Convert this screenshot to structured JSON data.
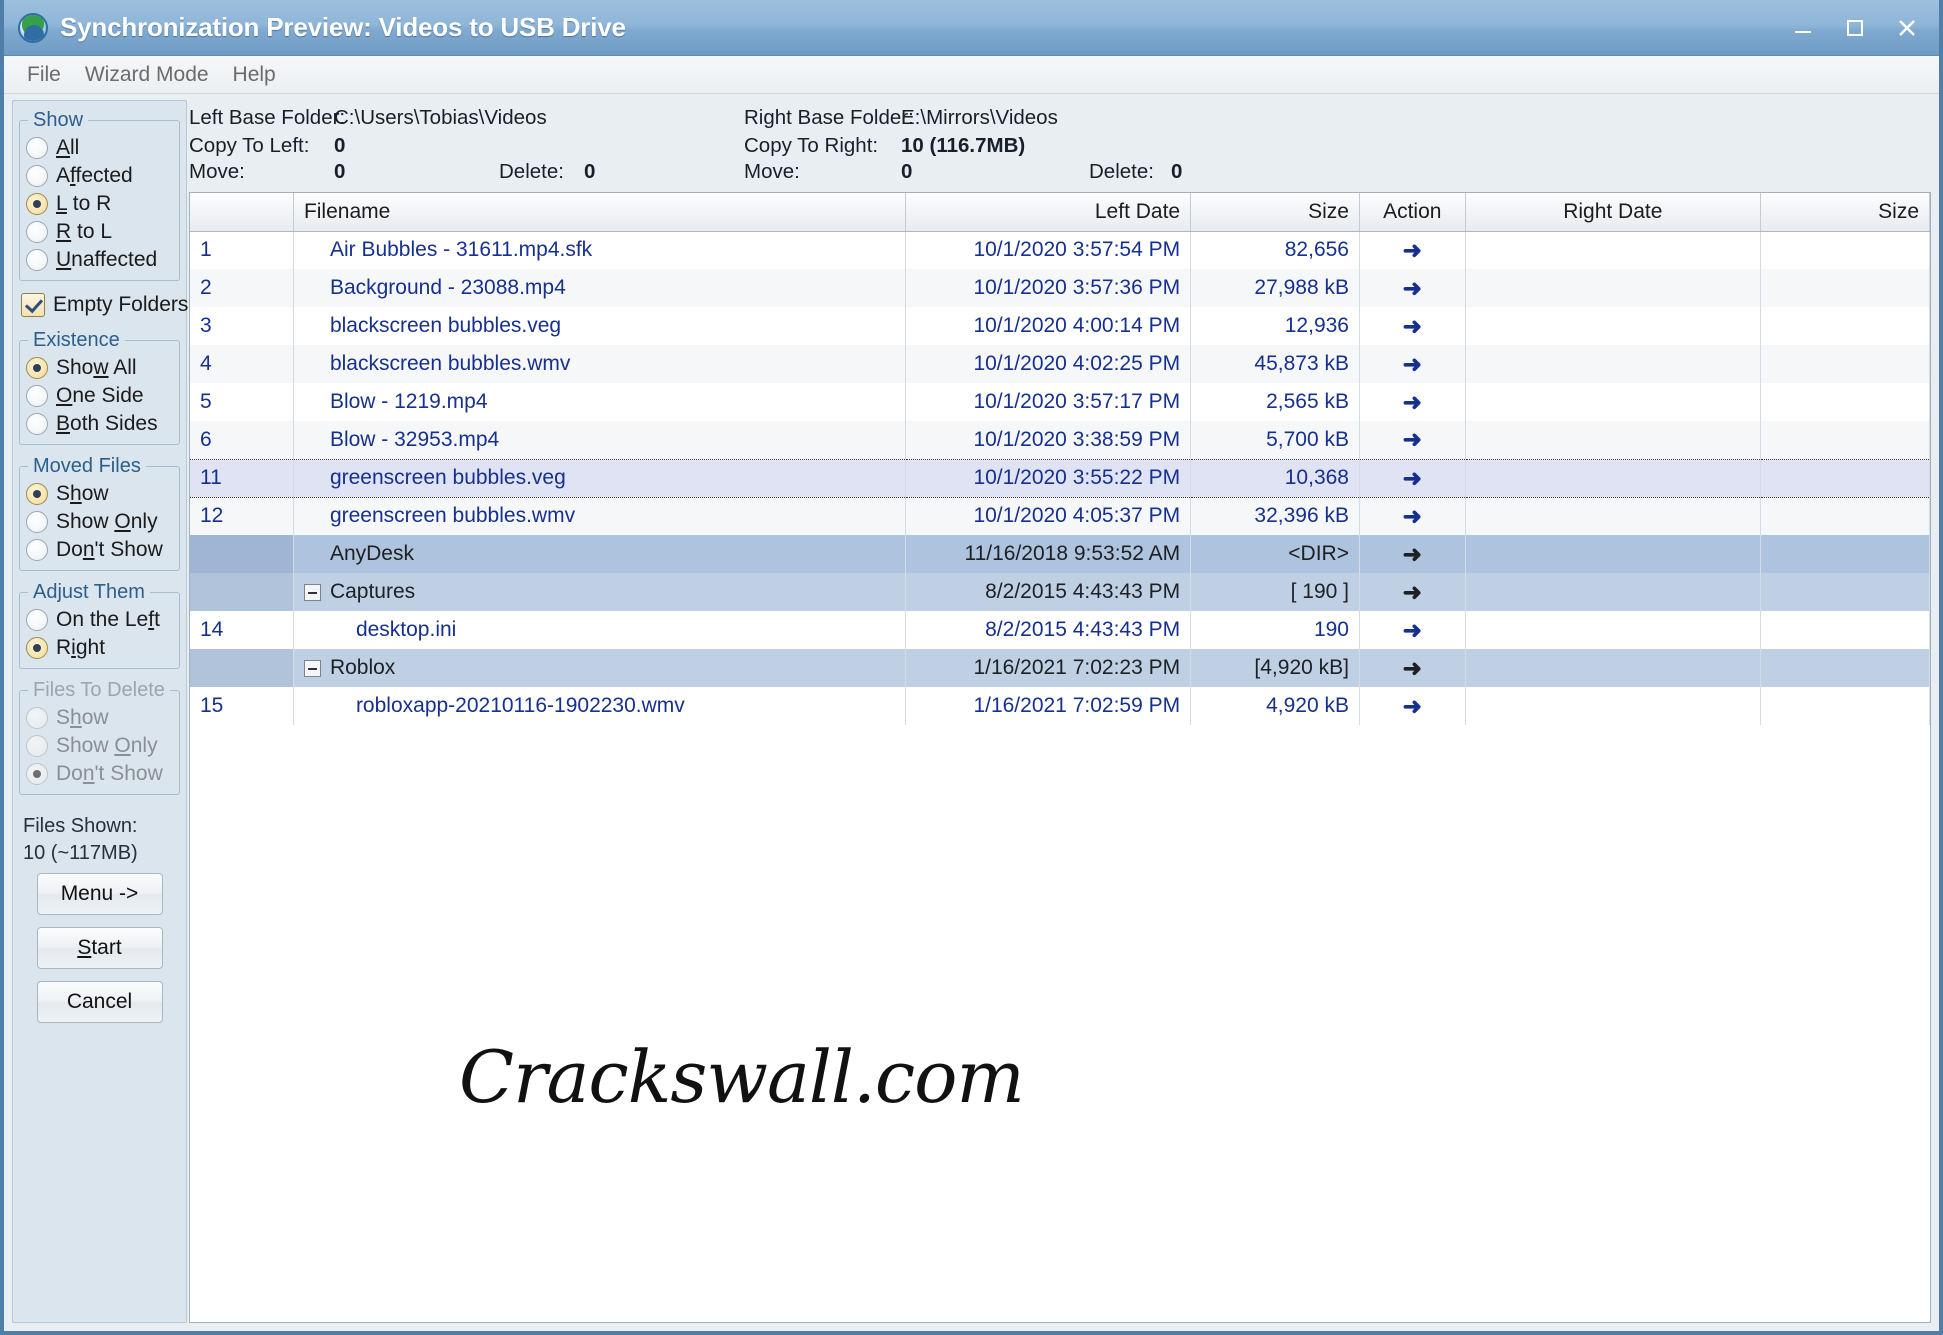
{
  "window": {
    "title": "Synchronization Preview: Videos to USB Drive",
    "minimize_label": "Minimize",
    "maximize_label": "Maximize",
    "close_label": "Close"
  },
  "menubar": {
    "items": [
      {
        "label": "File"
      },
      {
        "label": "Wizard Mode"
      },
      {
        "label": "Help"
      }
    ]
  },
  "sidebar": {
    "show_group": {
      "legend": "Show",
      "options": [
        {
          "label": "All",
          "accel": "A",
          "selected": false
        },
        {
          "label": "Affected",
          "accel": "f",
          "selected": false
        },
        {
          "label": "L to R",
          "accel": "L",
          "selected": true
        },
        {
          "label": "R to L",
          "accel": "R",
          "selected": false
        },
        {
          "label": "Unaffected",
          "accel": "U",
          "selected": false
        }
      ]
    },
    "empty_folders": {
      "label": "Empty Folders",
      "checked": true
    },
    "existence_group": {
      "legend": "Existence",
      "options": [
        {
          "label": "Show All",
          "accel": "w",
          "selected": true
        },
        {
          "label": "One Side",
          "accel": "O",
          "selected": false
        },
        {
          "label": "Both Sides",
          "accel": "B",
          "selected": false
        }
      ]
    },
    "moved_files_group": {
      "legend": "Moved Files",
      "options": [
        {
          "label": "Show",
          "accel": "h",
          "selected": true
        },
        {
          "label": "Show Only",
          "accel": "O",
          "selected": false
        },
        {
          "label": "Don't Show",
          "accel": "n",
          "selected": false
        }
      ]
    },
    "adjust_them_group": {
      "legend": "Adjust Them",
      "options": [
        {
          "label": "On the Left",
          "accel": "f",
          "selected": false
        },
        {
          "label": "Right",
          "accel": "i",
          "selected": true
        }
      ]
    },
    "files_to_delete_group": {
      "legend": "Files To Delete",
      "disabled": true,
      "options": [
        {
          "label": "Show",
          "accel": "h",
          "selected": false
        },
        {
          "label": "Show Only",
          "accel": "O",
          "selected": false
        },
        {
          "label": "Don't Show",
          "accel": "n",
          "selected": true
        }
      ]
    },
    "files_shown_label": "Files Shown:",
    "files_shown_value": "10 (~117MB)",
    "buttons": {
      "menu": "Menu ->",
      "start": "Start",
      "start_accel": "S",
      "cancel": "Cancel"
    }
  },
  "summary": {
    "left_base_folder_label": "Left Base Folder:",
    "left_base_folder_value": "C:\\Users\\Tobias\\Videos",
    "copy_to_left_label": "Copy To Left:",
    "copy_to_left_value": "0",
    "left_move_label": "Move:",
    "left_move_value": "0",
    "left_delete_label": "Delete:",
    "left_delete_value": "0",
    "right_base_folder_label": "Right Base Folder:",
    "right_base_folder_value": "E:\\Mirrors\\Videos",
    "copy_to_right_label": "Copy To Right:",
    "copy_to_right_value": "10 (116.7MB)",
    "right_move_label": "Move:",
    "right_move_value": "0",
    "right_delete_label": "Delete:",
    "right_delete_value": "0"
  },
  "table": {
    "columns": {
      "index": "",
      "filename": "Filename",
      "left_date": "Left Date",
      "left_size": "Size",
      "action": "Action",
      "right_date": "Right Date",
      "right_size": "Size"
    },
    "action_icon": "arrow-right-icon",
    "action_glyph": "➜",
    "rows": [
      {
        "index": "1",
        "name": "Air Bubbles - 31611.mp4.sfk",
        "left_date": "10/1/2020 3:57:54 PM",
        "left_size": "82,656",
        "action": "➜",
        "right_date": "",
        "right_size": "",
        "kind": "file",
        "indent": 0,
        "selected": false
      },
      {
        "index": "2",
        "name": "Background - 23088.mp4",
        "left_date": "10/1/2020 3:57:36 PM",
        "left_size": "27,988 kB",
        "action": "➜",
        "right_date": "",
        "right_size": "",
        "kind": "file",
        "indent": 0,
        "selected": false
      },
      {
        "index": "3",
        "name": "blackscreen bubbles.veg",
        "left_date": "10/1/2020 4:00:14 PM",
        "left_size": "12,936",
        "action": "➜",
        "right_date": "",
        "right_size": "",
        "kind": "file",
        "indent": 0,
        "selected": false
      },
      {
        "index": "4",
        "name": "blackscreen bubbles.wmv",
        "left_date": "10/1/2020 4:02:25 PM",
        "left_size": "45,873 kB",
        "action": "➜",
        "right_date": "",
        "right_size": "",
        "kind": "file",
        "indent": 0,
        "selected": false
      },
      {
        "index": "5",
        "name": "Blow - 1219.mp4",
        "left_date": "10/1/2020 3:57:17 PM",
        "left_size": "2,565 kB",
        "action": "➜",
        "right_date": "",
        "right_size": "",
        "kind": "file",
        "indent": 0,
        "selected": false
      },
      {
        "index": "6",
        "name": "Blow - 32953.mp4",
        "left_date": "10/1/2020 3:38:59 PM",
        "left_size": "5,700 kB",
        "action": "➜",
        "right_date": "",
        "right_size": "",
        "kind": "file",
        "indent": 0,
        "selected": false
      },
      {
        "index": "11",
        "name": "greenscreen bubbles.veg",
        "left_date": "10/1/2020 3:55:22 PM",
        "left_size": "10,368",
        "action": "➜",
        "right_date": "",
        "right_size": "",
        "kind": "file",
        "indent": 0,
        "selected": true
      },
      {
        "index": "12",
        "name": "greenscreen bubbles.wmv",
        "left_date": "10/1/2020 4:05:37 PM",
        "left_size": "32,396 kB",
        "action": "➜",
        "right_date": "",
        "right_size": "",
        "kind": "file",
        "indent": 0,
        "selected": false
      },
      {
        "index": "",
        "name": "AnyDesk",
        "left_date": "11/16/2018 9:53:52 AM",
        "left_size": "<DIR>",
        "action": "➜",
        "right_date": "",
        "right_size": "",
        "kind": "dir",
        "indent": 0,
        "selected": false,
        "expandable": false
      },
      {
        "index": "",
        "name": "Captures",
        "left_date": "8/2/2015 4:43:43 PM",
        "left_size": "[ 190  ]",
        "action": "➜",
        "right_date": "",
        "right_size": "",
        "kind": "dir-alt",
        "indent": 0,
        "selected": false,
        "expandable": true
      },
      {
        "index": "14",
        "name": "desktop.ini",
        "left_date": "8/2/2015 4:43:43 PM",
        "left_size": "190",
        "action": "➜",
        "right_date": "",
        "right_size": "",
        "kind": "file",
        "indent": 2,
        "selected": false
      },
      {
        "index": "",
        "name": "Roblox",
        "left_date": "1/16/2021 7:02:23 PM",
        "left_size": "[4,920 kB]",
        "action": "➜",
        "right_date": "",
        "right_size": "",
        "kind": "dir-alt",
        "indent": 0,
        "selected": false,
        "expandable": true
      },
      {
        "index": "15",
        "name": "robloxapp-20210116-1902230.wmv",
        "left_date": "1/16/2021 7:02:59 PM",
        "left_size": "4,920 kB",
        "action": "➜",
        "right_date": "",
        "right_size": "",
        "kind": "file",
        "indent": 2,
        "selected": false
      }
    ]
  },
  "watermark": {
    "text": "Crackswall.com"
  }
}
